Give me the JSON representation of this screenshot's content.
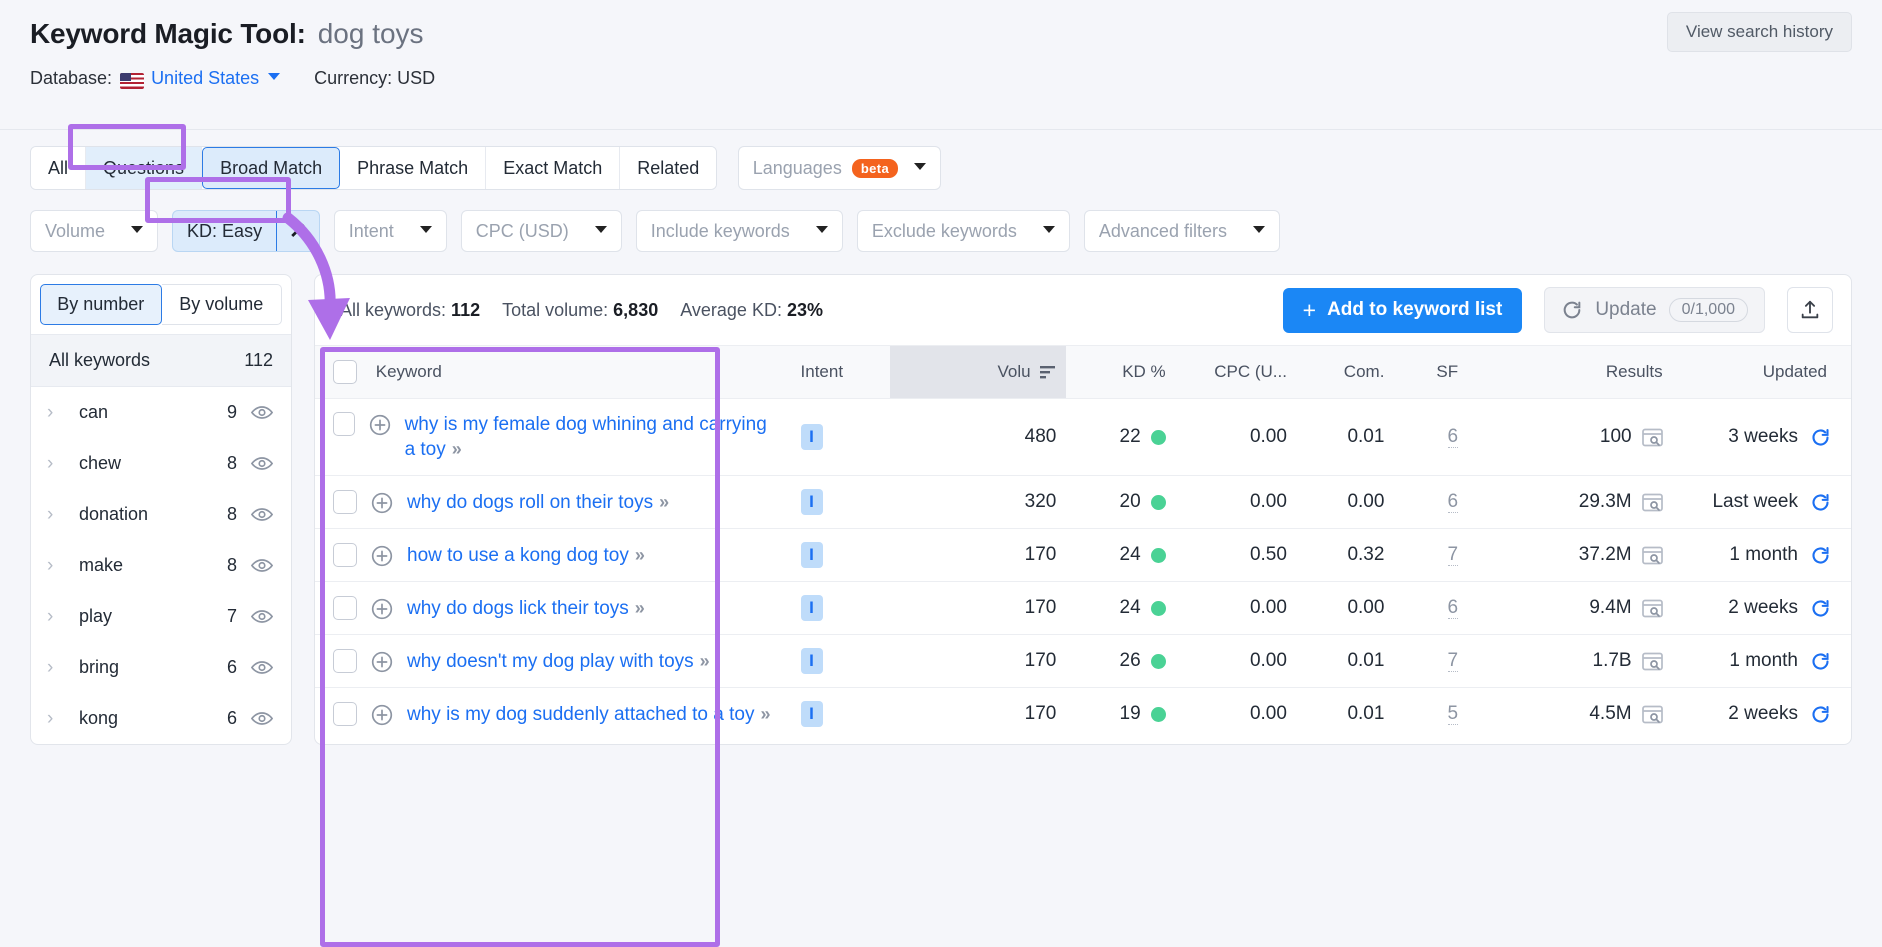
{
  "header": {
    "title": "Keyword Magic Tool:",
    "query": "dog toys",
    "database_label": "Database:",
    "database_value": "United States",
    "currency": "Currency: USD",
    "view_history": "View search history"
  },
  "match_tabs": [
    {
      "label": "All",
      "state": "normal"
    },
    {
      "label": "Questions",
      "state": "highlight"
    },
    {
      "label": "Broad Match",
      "state": "selected"
    },
    {
      "label": "Phrase Match",
      "state": "normal"
    },
    {
      "label": "Exact Match",
      "state": "normal"
    },
    {
      "label": "Related",
      "state": "normal"
    }
  ],
  "languages": {
    "label": "Languages",
    "badge": "beta"
  },
  "filters": [
    {
      "label": "Volume",
      "type": "dropdown"
    },
    {
      "label": "KD: Easy",
      "type": "chip"
    },
    {
      "label": "Intent",
      "type": "dropdown"
    },
    {
      "label": "CPC (USD)",
      "type": "dropdown"
    },
    {
      "label": "Include keywords",
      "type": "dropdown"
    },
    {
      "label": "Exclude keywords",
      "type": "dropdown"
    },
    {
      "label": "Advanced filters",
      "type": "dropdown"
    }
  ],
  "sidebar": {
    "toggle": [
      {
        "label": "By number",
        "active": true
      },
      {
        "label": "By volume",
        "active": false
      }
    ],
    "all_keywords_label": "All keywords",
    "all_keywords_count": "112",
    "items": [
      {
        "label": "can",
        "count": "9"
      },
      {
        "label": "chew",
        "count": "8"
      },
      {
        "label": "donation",
        "count": "8"
      },
      {
        "label": "make",
        "count": "8"
      },
      {
        "label": "play",
        "count": "7"
      },
      {
        "label": "bring",
        "count": "6"
      },
      {
        "label": "kong",
        "count": "6"
      }
    ]
  },
  "stats": {
    "all_keywords_label": "All keywords:",
    "all_keywords_value": "112",
    "total_volume_label": "Total volume:",
    "total_volume_value": "6,830",
    "average_kd_label": "Average KD:",
    "average_kd_value": "23%",
    "add_button": "Add to keyword list",
    "update_label": "Update",
    "update_quota": "0/1,000"
  },
  "table": {
    "columns": [
      "Keyword",
      "Intent",
      "Volu",
      "KD %",
      "CPC (U...",
      "Com.",
      "SF",
      "Results",
      "Updated"
    ],
    "rows": [
      {
        "keyword": "why is my female dog whining and carrying a toy",
        "intent": "I",
        "volume": "480",
        "kd": "22",
        "cpc": "0.00",
        "com": "0.01",
        "sf": "6",
        "results": "100",
        "updated": "3 weeks"
      },
      {
        "keyword": "why do dogs roll on their toys",
        "intent": "I",
        "volume": "320",
        "kd": "20",
        "cpc": "0.00",
        "com": "0.00",
        "sf": "6",
        "results": "29.3M",
        "updated": "Last week"
      },
      {
        "keyword": "how to use a kong dog toy",
        "intent": "I",
        "volume": "170",
        "kd": "24",
        "cpc": "0.50",
        "com": "0.32",
        "sf": "7",
        "results": "37.2M",
        "updated": "1 month"
      },
      {
        "keyword": "why do dogs lick their toys",
        "intent": "I",
        "volume": "170",
        "kd": "24",
        "cpc": "0.00",
        "com": "0.00",
        "sf": "6",
        "results": "9.4M",
        "updated": "2 weeks"
      },
      {
        "keyword": "why doesn't my dog play with toys",
        "intent": "I",
        "volume": "170",
        "kd": "26",
        "cpc": "0.00",
        "com": "0.01",
        "sf": "7",
        "results": "1.7B",
        "updated": "1 month"
      },
      {
        "keyword": "why is my dog suddenly attached to a toy",
        "intent": "I",
        "volume": "170",
        "kd": "19",
        "cpc": "0.00",
        "com": "0.01",
        "sf": "5",
        "results": "4.5M",
        "updated": "2 weeks"
      }
    ]
  },
  "colors": {
    "accent_blue": "#1b87f5",
    "link_blue": "#1b6ff2",
    "annotation_purple": "#ae6fe8",
    "kd_green": "#4ad295",
    "beta_orange": "#f4631e"
  }
}
